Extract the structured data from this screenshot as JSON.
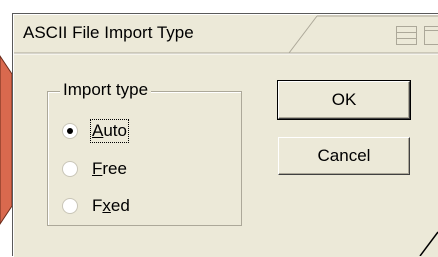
{
  "dialog": {
    "title": "ASCII File Import Type"
  },
  "group": {
    "label": "Import type",
    "options": [
      {
        "label": "Auto",
        "mnemonic": "A",
        "checked": true
      },
      {
        "label": "Free",
        "mnemonic": "F",
        "checked": false
      },
      {
        "label": "Fixed",
        "mnemonic": "x",
        "checked": false
      }
    ]
  },
  "buttons": {
    "ok_label": "OK",
    "cancel_label": "Cancel"
  },
  "colors": {
    "arrow": "#d9694e",
    "dialog_bg": "#ece9d8"
  }
}
